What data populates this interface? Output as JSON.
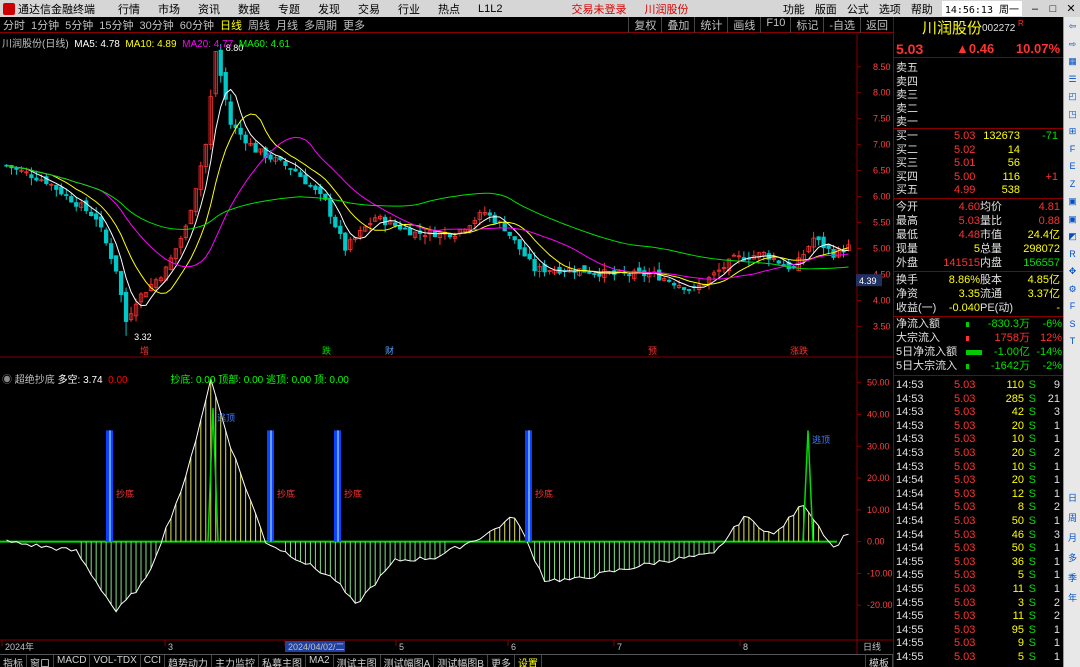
{
  "titlebar": {
    "app": "通达信金融终端",
    "menus": [
      "行情",
      "市场",
      "资讯",
      "数据",
      "专题",
      "发现",
      "交易",
      "行业",
      "热点",
      "L1L2"
    ],
    "login": "交易未登录",
    "stock": "川润股份",
    "right_menus": [
      "功能",
      "版面",
      "公式",
      "选项",
      "帮助"
    ],
    "clock": "14:56:13 周一"
  },
  "periods": [
    "分时",
    "1分钟",
    "5分钟",
    "15分钟",
    "30分钟",
    "60分钟",
    "日线",
    "周线",
    "月线",
    "多周期",
    "更多"
  ],
  "active_period": "日线",
  "tools": [
    "复权",
    "叠加",
    "统计",
    "画线",
    "F10",
    "标记",
    "-自选",
    "返回"
  ],
  "ma_header": {
    "name": "川润股份(日线)",
    "ma5": "MA5: 4.78",
    "ma10": "MA10: 4.89",
    "ma20": "MA20: 4.77",
    "ma60": "MA60: 4.61"
  },
  "price_axis": [
    "8.50",
    "8.00",
    "7.50",
    "7.00",
    "6.50",
    "6.00",
    "5.50",
    "5.00",
    "4.50",
    "4.00",
    "3.50"
  ],
  "current_price_tag": "4.39",
  "high_label": "8.80",
  "low_label": "3.32",
  "event_marks": [
    "增",
    "跌",
    "财",
    "预",
    "涨跌"
  ],
  "indicator_header": {
    "name": "超绝抄底",
    "val": "多空: 3.74",
    "v2": "0.00",
    "p1": "抄底: 0.00",
    "p2": "顶部: 0.00",
    "p3": "逃顶: 0.00",
    "p4": "顶: 0.00"
  },
  "ind_axis": [
    "50.00",
    "40.00",
    "30.00",
    "20.00",
    "10.00",
    "0.00",
    "-10.00",
    "-20.00"
  ],
  "ind_labels": [
    "抄底",
    "抄底",
    "抄底",
    "抄底",
    "逃顶",
    "逃顶"
  ],
  "date_axis": [
    "2024年",
    "3",
    "2024/04/02/二",
    "5",
    "6",
    "7",
    "8"
  ],
  "period_tag": "日线",
  "quote": {
    "name": "川润股份",
    "code": "002272",
    "r": "R",
    "price": "5.03",
    "change": "▲0.46",
    "pct": "10.07%",
    "sells": [
      [
        "卖五",
        "",
        ""
      ],
      [
        "卖四",
        "",
        ""
      ],
      [
        "卖三",
        "",
        ""
      ],
      [
        "卖二",
        "",
        ""
      ],
      [
        "卖一",
        "",
        ""
      ]
    ],
    "buys": [
      [
        "买一",
        "5.03",
        "132673",
        "-71"
      ],
      [
        "买二",
        "5.02",
        "14",
        ""
      ],
      [
        "买三",
        "5.01",
        "56",
        ""
      ],
      [
        "买四",
        "5.00",
        "116",
        "+1"
      ],
      [
        "买五",
        "4.99",
        "538",
        ""
      ]
    ],
    "stats": [
      [
        "今开",
        "4.60",
        "均价",
        "4.81"
      ],
      [
        "最高",
        "5.03",
        "量比",
        "0.88"
      ],
      [
        "最低",
        "4.48",
        "市值",
        "24.4亿"
      ],
      [
        "现量",
        "5",
        "总量",
        "298072"
      ],
      [
        "外盘",
        "141515",
        "内盘",
        "156557"
      ]
    ],
    "stats2": [
      [
        "换手",
        "8.86%",
        "股本",
        "4.85亿"
      ],
      [
        "净资",
        "3.35",
        "流通",
        "3.37亿"
      ],
      [
        "收益(一)",
        "-0.040",
        "PE(动)",
        "-"
      ]
    ],
    "flows": [
      [
        "净流入额",
        "-830.3万",
        "-6%"
      ],
      [
        "大宗流入",
        "1758万",
        "12%"
      ],
      [
        "5日净流入额",
        "-1.00亿",
        "-14%"
      ],
      [
        "5日大宗流入",
        "-1642万",
        "-2%"
      ]
    ],
    "ticks": [
      [
        "14:53",
        "5.03",
        "110",
        "S",
        "9"
      ],
      [
        "14:53",
        "5.03",
        "285",
        "S",
        "21"
      ],
      [
        "14:53",
        "5.03",
        "42",
        "S",
        "3"
      ],
      [
        "14:53",
        "5.03",
        "20",
        "S",
        "1"
      ],
      [
        "14:53",
        "5.03",
        "10",
        "S",
        "1"
      ],
      [
        "14:53",
        "5.03",
        "20",
        "S",
        "2"
      ],
      [
        "14:53",
        "5.03",
        "10",
        "S",
        "1"
      ],
      [
        "14:54",
        "5.03",
        "20",
        "S",
        "1"
      ],
      [
        "14:54",
        "5.03",
        "12",
        "S",
        "1"
      ],
      [
        "14:54",
        "5.03",
        "8",
        "S",
        "2"
      ],
      [
        "14:54",
        "5.03",
        "50",
        "S",
        "1"
      ],
      [
        "14:54",
        "5.03",
        "46",
        "S",
        "3"
      ],
      [
        "14:54",
        "5.03",
        "50",
        "S",
        "1"
      ],
      [
        "14:55",
        "5.03",
        "36",
        "S",
        "1"
      ],
      [
        "14:55",
        "5.03",
        "5",
        "S",
        "1"
      ],
      [
        "14:55",
        "5.03",
        "11",
        "S",
        "1"
      ],
      [
        "14:55",
        "5.03",
        "3",
        "S",
        "2"
      ],
      [
        "14:55",
        "5.03",
        "11",
        "S",
        "2"
      ],
      [
        "14:55",
        "5.03",
        "95",
        "S",
        "1"
      ],
      [
        "14:55",
        "5.03",
        "9",
        "S",
        "1"
      ],
      [
        "14:55",
        "5.03",
        "5",
        "S",
        "1"
      ]
    ]
  },
  "bottom_tabs": [
    "指标",
    "窗口",
    "MACD",
    "VOL-TDX",
    "CCI",
    "趋势动力",
    "主力监控",
    "私募主图",
    "MA2",
    "测试主图",
    "测试幅图A",
    "测试幅图B",
    "更多",
    "设置"
  ],
  "bottom_right": "模板",
  "toolbar_icons": [
    "arrow-left-icon",
    "arrow-right-icon",
    "grid-icon",
    "list-icon",
    "chart-icon",
    "chart2-icon",
    "chart3-icon",
    "f10-icon",
    "fe-icon",
    "fz-icon",
    "cube-icon",
    "cube2-icon",
    "chart4-icon",
    "rsi-icon",
    "move-icon",
    "tool-icon",
    "f-icon",
    "s-icon",
    "t-icon"
  ],
  "toolbar_text": [
    "日",
    "周",
    "月",
    "多",
    "季",
    "年"
  ]
}
